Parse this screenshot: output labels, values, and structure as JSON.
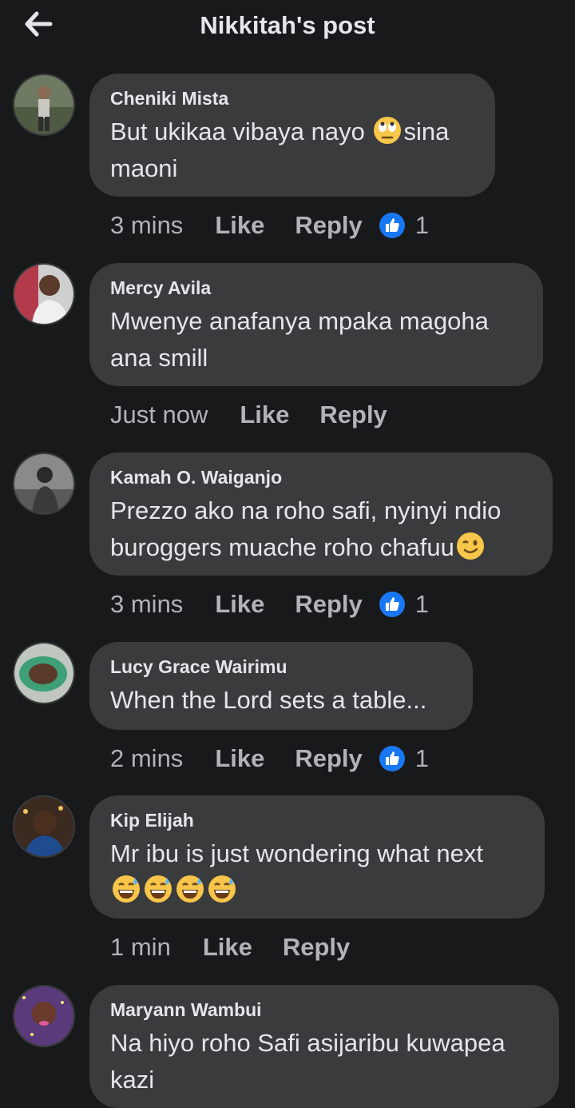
{
  "header": {
    "title": "Nikkitah's post"
  },
  "labels": {
    "like": "Like",
    "reply": "Reply"
  },
  "comments": [
    {
      "author": "Cheniki Mista",
      "text_before": "But ukikaa vibaya nayo ",
      "text_after": "sina maoni",
      "emoji": "rolling-eyes-emoji",
      "time": "3 mins",
      "reactions": "1"
    },
    {
      "author": "Mercy Avila",
      "text": "Mwenye anafanya mpaka magoha ana smill",
      "time": "Just now"
    },
    {
      "author": "Kamah O. Waiganjo",
      "text": "Prezzo ako na roho safi, nyinyi ndio buroggers muache roho chafuu",
      "emoji": "winking-face-emoji",
      "time": "3 mins",
      "reactions": "1"
    },
    {
      "author": "Lucy Grace Wairimu",
      "text": "When the Lord sets a table...",
      "time": "2 mins",
      "reactions": "1"
    },
    {
      "author": "Kip Elijah",
      "text": "Mr ibu is just wondering what next",
      "emoji": "grinning-sweat-emoji",
      "time": "1 min"
    },
    {
      "author": "Maryann Wambui",
      "text": "Na hiyo roho Safi asijaribu kuwapea kazi"
    }
  ],
  "colors": {
    "background": "#18191a",
    "bubble": "#3a3b3c",
    "like_badge": "#1877f2"
  }
}
